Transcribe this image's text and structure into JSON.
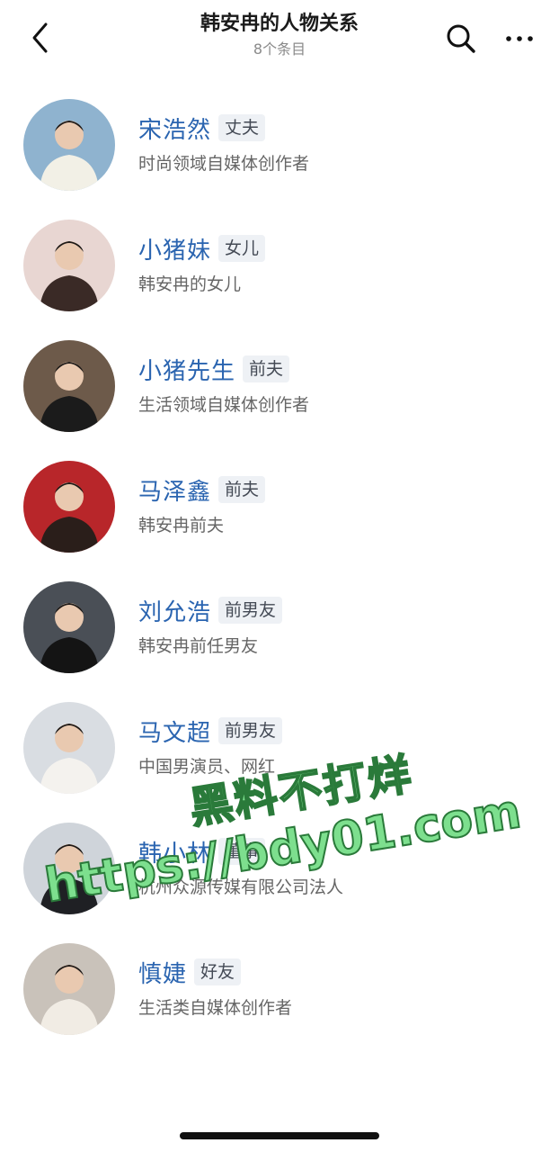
{
  "header": {
    "title": "韩安冉的人物关系",
    "subtitle": "8个条目",
    "back_icon": "chevron-left-icon",
    "search_icon": "search-icon",
    "more_icon": "more-horizontal-icon"
  },
  "colors": {
    "name": "#2a64b0",
    "tag_bg": "#eef1f5",
    "watermark": "#7ddf8e"
  },
  "relations": [
    {
      "name": "宋浩然",
      "tag": "丈夫",
      "desc": "时尚领域自媒体创作者",
      "avatar_bg": "#8fb3cf",
      "avatar_fg": "#f2f0e6"
    },
    {
      "name": "小猪妹",
      "tag": "女儿",
      "desc": "韩安冉的女儿",
      "avatar_bg": "#e8d6d2",
      "avatar_fg": "#3a2a26"
    },
    {
      "name": "小猪先生",
      "tag": "前夫",
      "desc": "生活领域自媒体创作者",
      "avatar_bg": "#6d5a4a",
      "avatar_fg": "#1b1b1b"
    },
    {
      "name": "马泽鑫",
      "tag": "前夫",
      "desc": "韩安冉前夫",
      "avatar_bg": "#b8262a",
      "avatar_fg": "#2a1e1a"
    },
    {
      "name": "刘允浩",
      "tag": "前男友",
      "desc": "韩安冉前任男友",
      "avatar_bg": "#4a4f56",
      "avatar_fg": "#141414"
    },
    {
      "name": "马文超",
      "tag": "前男友",
      "desc": "中国男演员、网红",
      "avatar_bg": "#d9dde2",
      "avatar_fg": "#f4f2ee"
    },
    {
      "name": "韩小林",
      "tag": "董事",
      "desc": "杭州众源传媒有限公司法人",
      "avatar_bg": "#cfd4da",
      "avatar_fg": "#1f2024"
    },
    {
      "name": "慎婕",
      "tag": "好友",
      "desc": "生活类自媒体创作者",
      "avatar_bg": "#c9c2ba",
      "avatar_fg": "#f1ece4"
    }
  ],
  "watermark": {
    "line1": "黑料不打烊",
    "line2": "https://bdy01.com"
  }
}
